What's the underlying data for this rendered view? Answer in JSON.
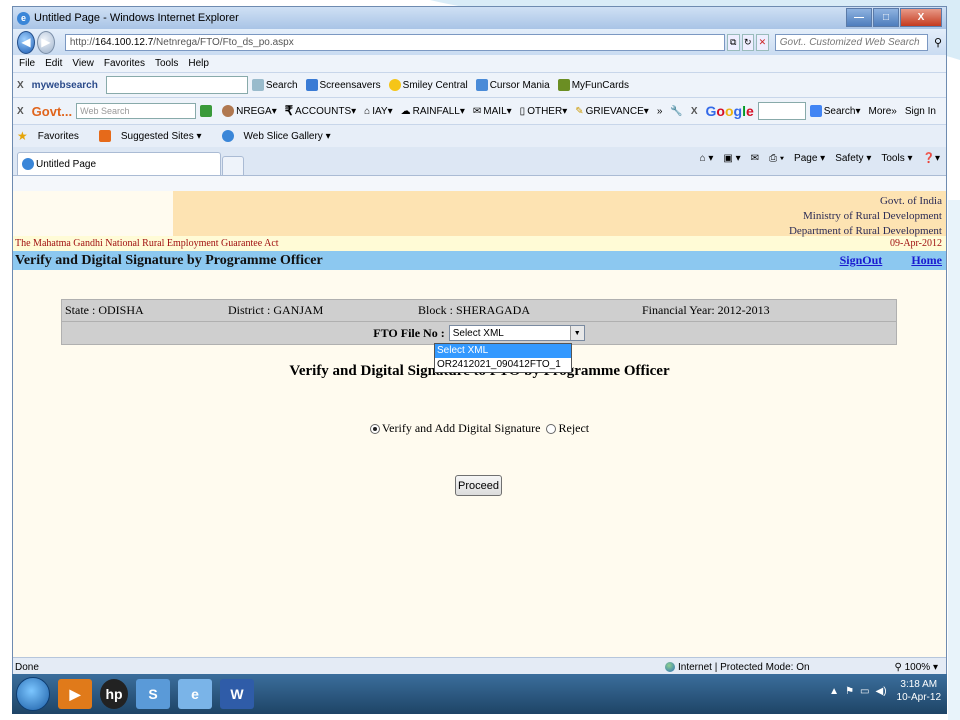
{
  "window": {
    "title": "Untitled Page - Windows Internet Explorer",
    "controls": [
      "—",
      "□",
      "X"
    ]
  },
  "address": {
    "url_prefix": "http://",
    "url_host": "164.100.12.7",
    "url_path": "/Netnrega/FTO/Fto_ds_po.aspx",
    "live_search_placeholder": "Govt.. Customized Web Search"
  },
  "menu": [
    "File",
    "Edit",
    "View",
    "Favorites",
    "Tools",
    "Help"
  ],
  "toolbar1": {
    "brand": "mywebsearch",
    "search_btn": "Search",
    "items": [
      "Screensavers",
      "Smiley Central",
      "Cursor Mania",
      "MyFunCards"
    ]
  },
  "toolbar2": {
    "brand": "Govt...",
    "search_placeholder": "Web Search",
    "items": [
      "NREGA",
      "ACCOUNTS",
      "IAY",
      "RAINFALL",
      "MAIL",
      "OTHER",
      "GRIEVANCE"
    ],
    "google": "Google",
    "google_search": "Search",
    "more": "More»",
    "signin": "Sign In"
  },
  "favorites": {
    "label": "Favorites",
    "items": [
      "Suggested Sites ▾",
      "Web Slice Gallery ▾"
    ]
  },
  "tab": {
    "title": "Untitled Page"
  },
  "commandbar": [
    "Page ▾",
    "Safety ▾",
    "Tools ▾"
  ],
  "page": {
    "gov": [
      "Govt. of India",
      "Ministry of Rural Development",
      "Department of Rural Development"
    ],
    "act": "The Mahatma Gandhi National Rural Employment Guarantee Act",
    "date": "09-Apr-2012",
    "heading": "Verify and Digital Signature by Programme Officer",
    "links": {
      "signout": "SignOut",
      "home": "Home"
    },
    "info": {
      "state": "State : ODISHA",
      "district": "District : GANJAM",
      "block": "Block : SHERAGADA",
      "fy": "Financial Year: 2012-2013"
    },
    "fto_label": "FTO File No :",
    "fto_selected": "Select XML",
    "fto_options": [
      "Select XML",
      "OR2412021_090412FTO_1"
    ],
    "subtitle": "Verify and Digital Signature to FTO by Programme Officer",
    "radio_verify": "Verify and Add Digital Signature",
    "radio_reject": "Reject",
    "proceed": "Proceed"
  },
  "status": {
    "left": "Done",
    "zone": "Internet | Protected Mode: On",
    "zoom": "100%"
  },
  "clock": {
    "time": "3:18 AM",
    "date": "10-Apr-12"
  }
}
